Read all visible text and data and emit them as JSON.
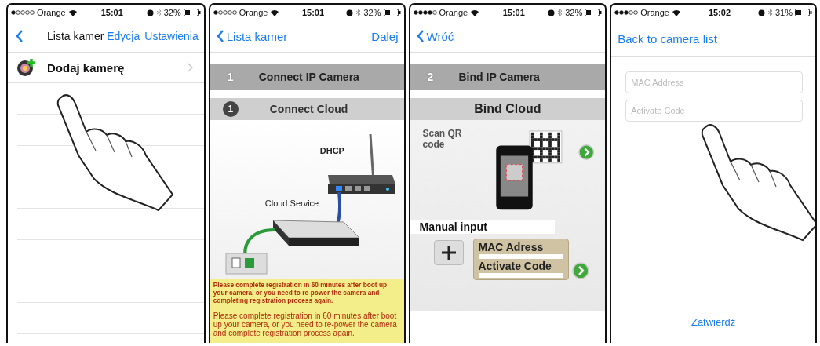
{
  "screens": [
    {
      "kind": "list",
      "status": {
        "carrier": "Orange",
        "time": "15:01",
        "battery": "32%"
      },
      "nav": {
        "title": "Lista kamer",
        "actions": [
          "Edycja",
          "Ustawienia"
        ]
      },
      "rows": [
        {
          "label": "Dodaj kamerę"
        }
      ]
    },
    {
      "kind": "connect",
      "status": {
        "carrier": "Orange",
        "time": "15:01",
        "battery": "32%"
      },
      "nav": {
        "back": "Lista kamer",
        "actions": [
          "Dalej"
        ]
      },
      "step": {
        "number": "1",
        "title": "Connect IP Camera"
      },
      "substep": {
        "number": "1",
        "title": "Connect Cloud"
      },
      "diagram_labels": [
        "DHCP",
        "Cloud Service"
      ],
      "notices": [
        "Please complete registration in 60 minutes after boot up your camera, or you need to re-power the camera and completing registration process again.",
        "Please complete registration in 60 minutes after boot up your camera, or you need to re-power the camera and complete registration process again."
      ]
    },
    {
      "kind": "bind",
      "status": {
        "carrier": "Orange",
        "time": "15:01",
        "battery": "32%"
      },
      "nav": {
        "back": "Wróć"
      },
      "step": {
        "number": "2",
        "title": "Bind IP Camera"
      },
      "section": "Bind Cloud",
      "scan_label": "Scan QR code",
      "manual_label": "Manual input",
      "card_labels": [
        "MAC Adress",
        "Activate Code"
      ]
    },
    {
      "kind": "form",
      "status": {
        "carrier": "Orange",
        "time": "15:02",
        "battery": "31%"
      },
      "nav": {
        "back": "Back to camera list"
      },
      "fields": [
        {
          "placeholder": "MAC Address"
        },
        {
          "placeholder": "Activate Code"
        }
      ],
      "submit": "Zatwierdź"
    }
  ]
}
